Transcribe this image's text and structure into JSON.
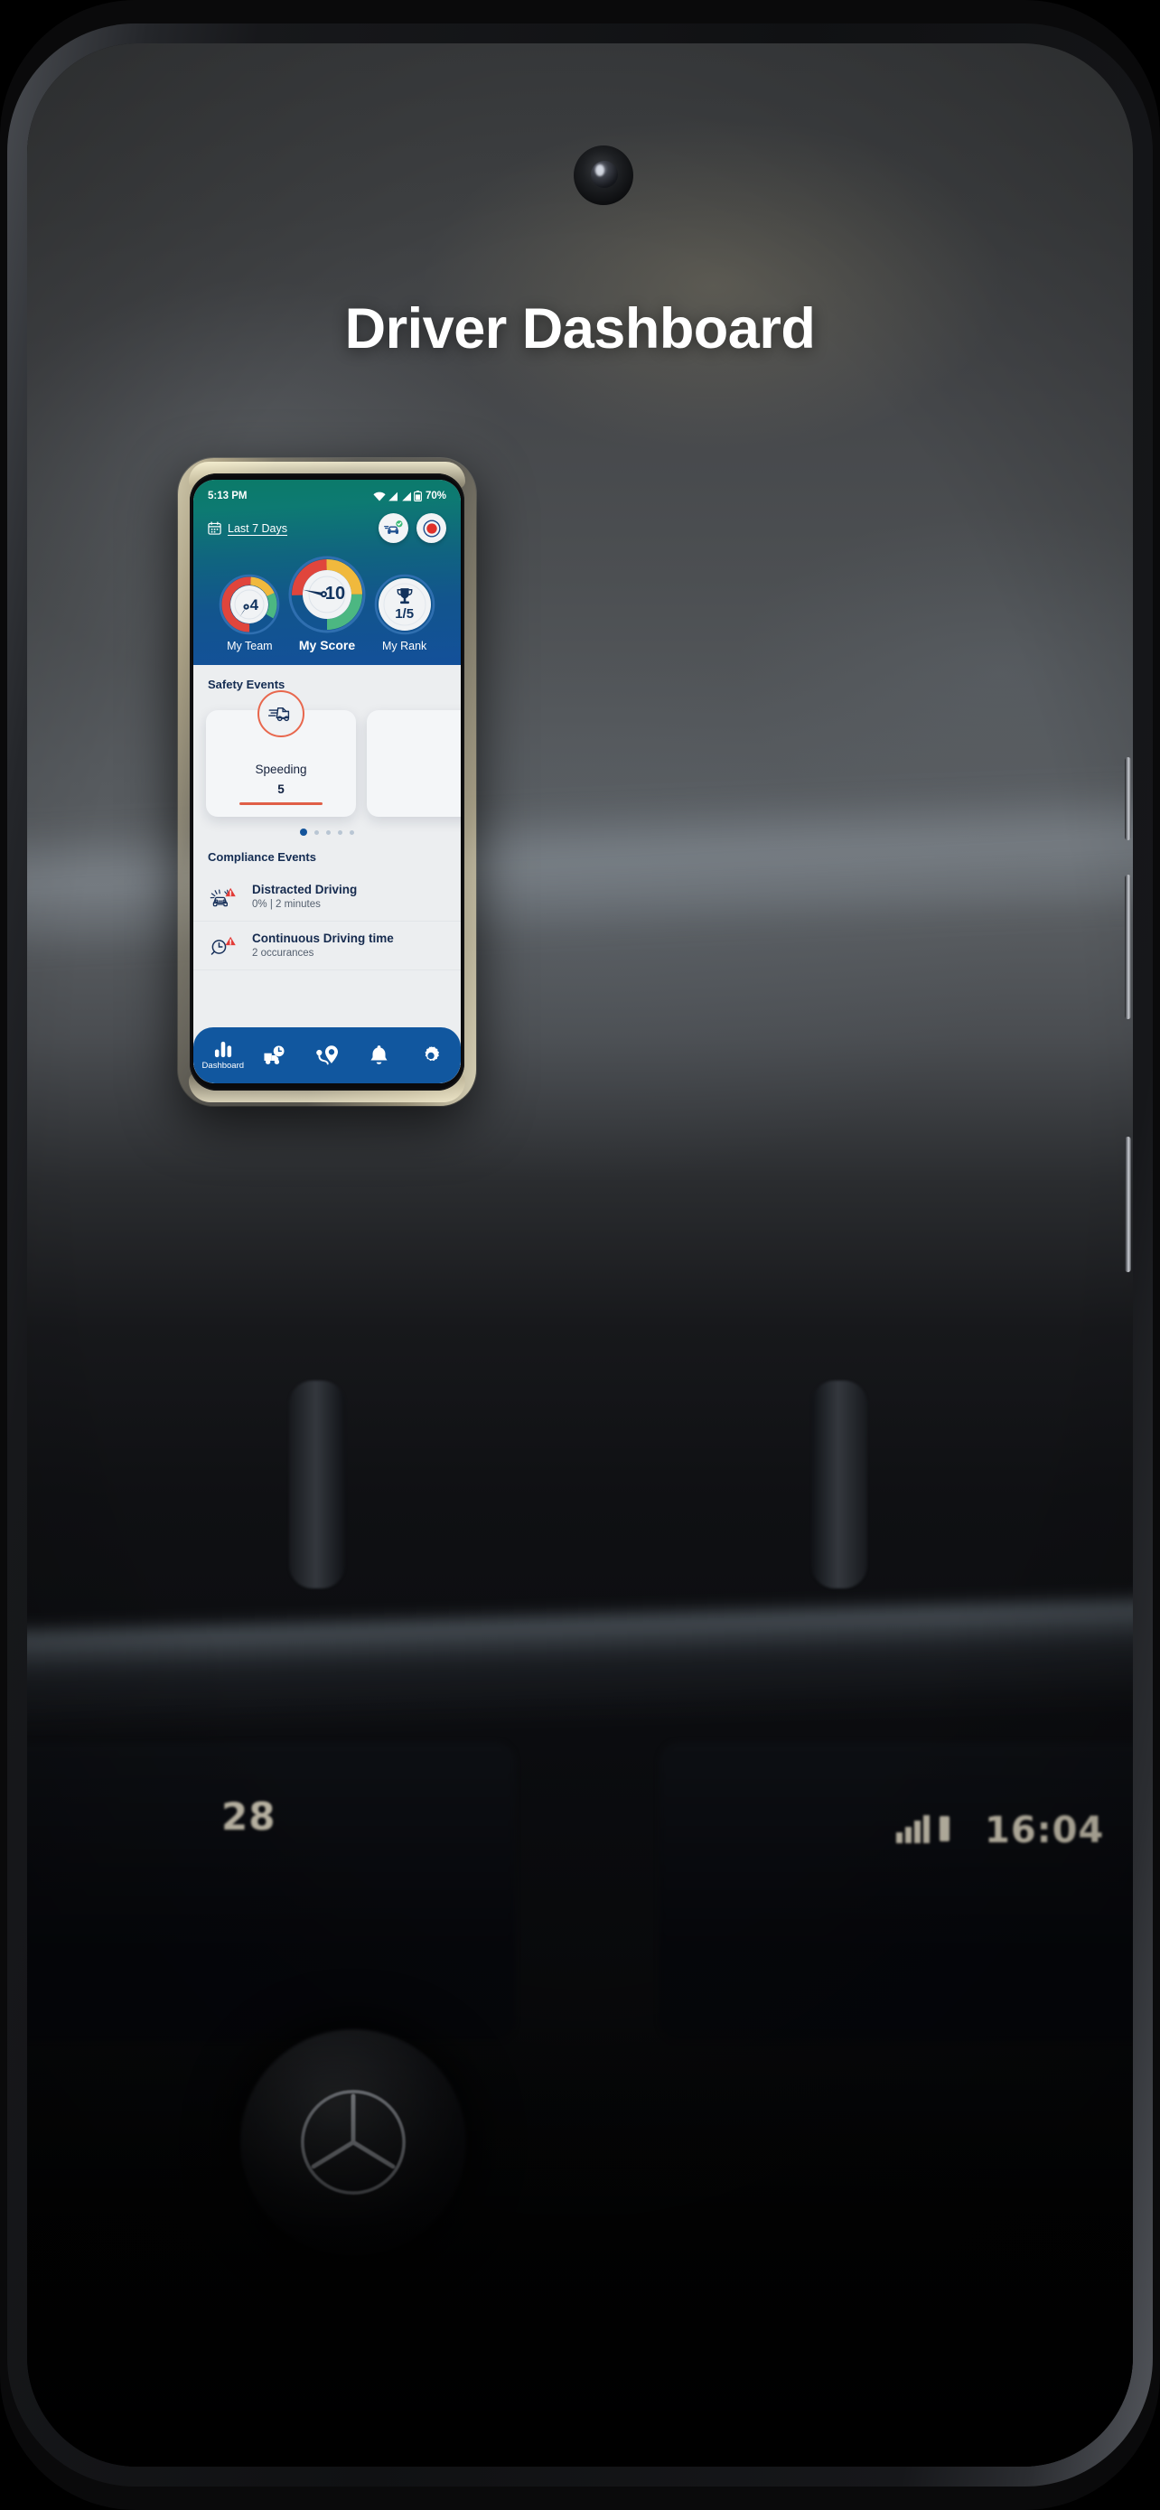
{
  "page": {
    "title": "Driver Dashboard"
  },
  "background": {
    "scene": "car-dashboard-interior",
    "vehicle_display_left": "28",
    "vehicle_display_right": "16:04"
  },
  "phone": {
    "status_bar": {
      "time": "5:13 PM",
      "wifi_icon": "wifi-icon",
      "signal_icon_1": "signal-bars-icon",
      "signal_icon_2": "signal-bars-icon",
      "battery_icon": "battery-icon",
      "battery_level": "70%"
    },
    "header": {
      "calendar_icon": "calendar-icon",
      "date_range": "Last 7 Days",
      "actions": [
        {
          "name": "vehicle-status-button",
          "icon": "car-check-icon"
        },
        {
          "name": "record-trip-button",
          "icon": "record-target-icon"
        }
      ]
    },
    "gauges": [
      {
        "name": "my-team-gauge",
        "value": "4",
        "label": "My Team",
        "primary": false
      },
      {
        "name": "my-score-gauge",
        "value": "10",
        "label": "My Score",
        "primary": true
      },
      {
        "name": "my-rank-gauge",
        "value": "1/5",
        "label": "My Rank",
        "primary": false,
        "icon": "trophy-icon"
      }
    ],
    "safety_events": {
      "section_title": "Safety Events",
      "cards": [
        {
          "name": "Speeding",
          "count": "5",
          "icon": "speeding-truck-icon"
        },
        {
          "name": "",
          "count": "",
          "icon": ""
        }
      ],
      "dots_total": 5,
      "dots_active_index": 0
    },
    "compliance_events": {
      "section_title": "Compliance Events",
      "rows": [
        {
          "title": "Distracted Driving",
          "subtitle": "0% | 2 minutes",
          "icon": "distracted-driving-alert-icon"
        },
        {
          "title": "Continuous Driving time",
          "subtitle": "2 occurances",
          "icon": "clock-alert-icon"
        }
      ]
    },
    "bottom_nav": [
      {
        "label": "Dashboard",
        "icon": "bar-chart-icon",
        "active": true
      },
      {
        "label": "",
        "icon": "truck-clock-icon",
        "active": false
      },
      {
        "label": "",
        "icon": "route-pin-icon",
        "active": false
      },
      {
        "label": "",
        "icon": "bell-icon",
        "active": false
      },
      {
        "label": "",
        "icon": "gear-icon",
        "active": false
      }
    ]
  },
  "colors": {
    "header_teal": "#0b7a68",
    "header_blue": "#13509a",
    "nav_blue": "#11579f",
    "accent_orange": "#e05f47",
    "gauge_green": "#4cb782",
    "gauge_yellow": "#f0b93d",
    "gauge_red": "#e0453c",
    "dark_navy": "#142c52"
  }
}
